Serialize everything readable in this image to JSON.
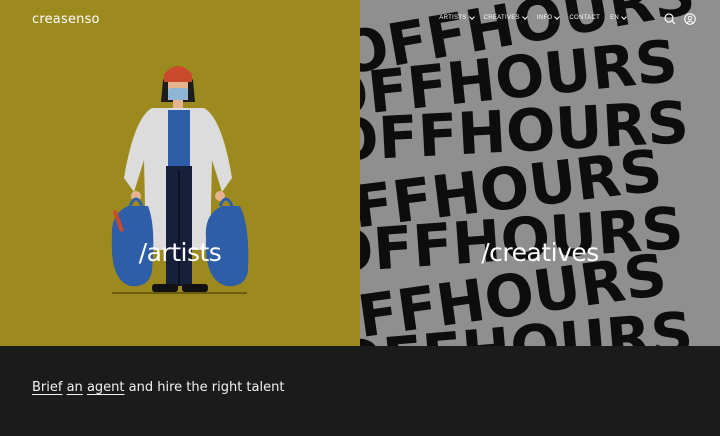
{
  "brand": {
    "logo": "creasenso"
  },
  "nav": {
    "items": [
      {
        "label": "ARTISTS",
        "dropdown": true
      },
      {
        "label": "CREATIVES",
        "dropdown": true
      },
      {
        "label": "INFO",
        "dropdown": true
      },
      {
        "label": "CONTACT",
        "dropdown": false
      },
      {
        "label": "EN",
        "dropdown": true
      }
    ],
    "icons": [
      "search-icon",
      "user-icon"
    ]
  },
  "hero": {
    "artists_label": "/artists",
    "creatives_label": "/creatives",
    "artists_color": "#9d8a1e",
    "creatives_color": "#8f8f8f",
    "creatives_pattern_text": "OFFHOURS"
  },
  "footer": {
    "words": [
      "Brief",
      "an",
      "agent"
    ],
    "rest": "and hire the right talent"
  }
}
